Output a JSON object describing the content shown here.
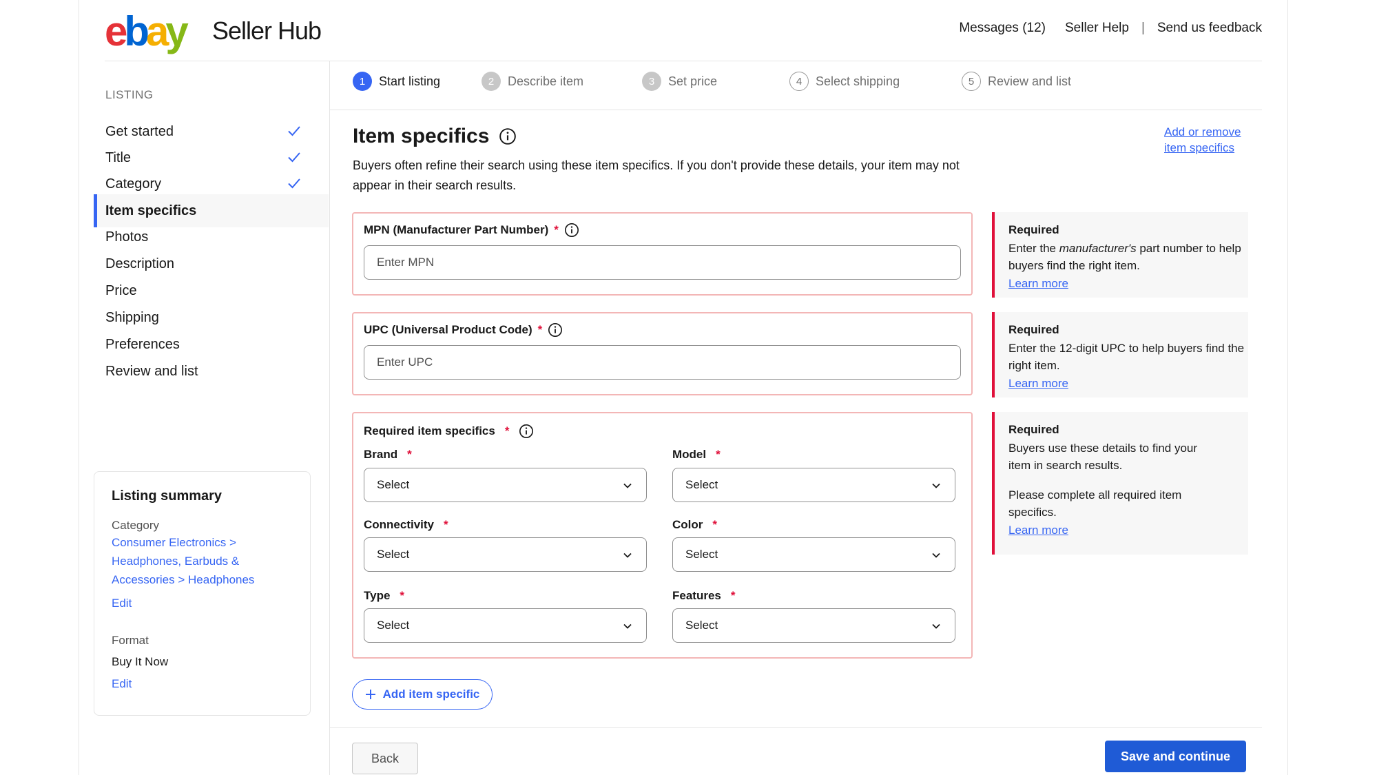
{
  "brand": {
    "logo_letters": [
      "e",
      "b",
      "a",
      "y"
    ],
    "logo_colors": [
      "#e53238",
      "#0064d2",
      "#f5af02",
      "#86b817"
    ],
    "app_title": "Seller Hub"
  },
  "header": {
    "messages_label": "Messages (12)",
    "help_label": "Seller Help",
    "separator": "|",
    "feedback_label": "Send us feedback"
  },
  "sidebar": {
    "heading": "LISTING",
    "items": [
      {
        "label": "Get started",
        "completed": true
      },
      {
        "label": "Title",
        "completed": true
      },
      {
        "label": "Category",
        "completed": true
      },
      {
        "label": "Item specifics",
        "active": true
      },
      {
        "label": "Photos"
      },
      {
        "label": "Description"
      },
      {
        "label": "Price"
      },
      {
        "label": "Shipping"
      },
      {
        "label": "Preferences"
      },
      {
        "label": "Review and list"
      }
    ],
    "summary": {
      "title": "Listing summary",
      "category_label": "Category",
      "category_path_1": "Consumer Electronics >",
      "category_path_2": "Headphones, Earbuds &",
      "category_path_3": "Accessories > Headphones",
      "category_edit": "Edit",
      "format_label": "Format",
      "format_value": "Buy It Now",
      "format_edit": "Edit"
    }
  },
  "stepper": {
    "steps": [
      {
        "number": "1",
        "label": "Start listing",
        "state": "current"
      },
      {
        "number": "2",
        "label": "Describe item",
        "state": "done"
      },
      {
        "number": "3",
        "label": "Set price",
        "state": "done"
      },
      {
        "number": "4",
        "label": "Select shipping",
        "state": "todo"
      },
      {
        "number": "5",
        "label": "Review and list",
        "state": "todo"
      }
    ]
  },
  "main": {
    "title": "Item specifics",
    "description": "Buyers often refine their search using these item specifics. If you don't provide these details, your item may not appear in their search results.",
    "add_remove_line1": "Add or remove",
    "add_remove_line2": "item specifics",
    "mpn": {
      "label": "MPN (Manufacturer Part Number)",
      "required_mark": "*",
      "placeholder": "Enter MPN"
    },
    "upc": {
      "label": "UPC (Universal Product Code)",
      "required_mark": "*",
      "placeholder": "Enter UPC"
    },
    "required_specifics": {
      "label": "Required item specifics",
      "required_mark": "*",
      "fields": [
        {
          "label": "Brand",
          "value": "Select"
        },
        {
          "label": "Model",
          "value": "Select"
        },
        {
          "label": "Connectivity",
          "value": "Select"
        },
        {
          "label": "Color",
          "value": "Select"
        },
        {
          "label": "Type",
          "value": "Select"
        },
        {
          "label": "Features",
          "value": "Select"
        }
      ]
    },
    "add_item_specific": "Add item specific",
    "back_label": "Back",
    "save_label": "Save and continue"
  },
  "tips": {
    "mpn": {
      "heading": "Required",
      "text_pre": "Enter the ",
      "text_em": "manufacturer's",
      "text_post": " part number to help buyers find the right item.",
      "link": "Learn more"
    },
    "upc": {
      "heading": "Required",
      "text": "Enter the 12-digit UPC to help buyers find the right item.",
      "link": "Learn more"
    },
    "specifics": {
      "heading": "Required",
      "text1": "Buyers use these details to find your item in search results.",
      "text2": "Please complete all required item specifics.",
      "link": "Learn more"
    }
  }
}
